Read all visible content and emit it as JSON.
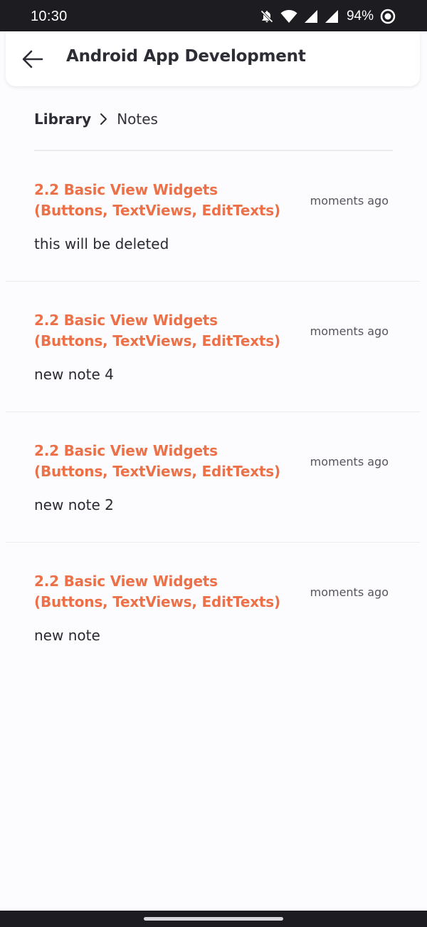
{
  "status_bar": {
    "time": "10:30",
    "battery_percent": "94%",
    "icons": [
      "notifications-off-icon",
      "wifi-icon",
      "signal-icon",
      "signal-icon",
      "battery-icon"
    ]
  },
  "header": {
    "title": "Android App Development",
    "back_icon": "arrow-left-icon"
  },
  "breadcrumb": {
    "items": [
      "Library",
      "Notes"
    ],
    "separator_icon": "chevron-right-icon"
  },
  "notes": [
    {
      "title": "2.2 Basic View Widgets (Buttons, TextViews, EditTexts)",
      "time": "moments ago",
      "body": "this will be deleted"
    },
    {
      "title": "2.2 Basic View Widgets (Buttons, TextViews, EditTexts)",
      "time": "moments ago",
      "body": "new note 4"
    },
    {
      "title": "2.2 Basic View Widgets (Buttons, TextViews, EditTexts)",
      "time": "moments ago",
      "body": "new note 2"
    },
    {
      "title": "2.2 Basic View Widgets (Buttons, TextViews, EditTexts)",
      "time": "moments ago",
      "body": "new note"
    }
  ],
  "colors": {
    "accent": "#ec7048",
    "text_dark": "#2d2d35",
    "background": "#fcfbfd",
    "system_bar": "#1d1d21"
  }
}
